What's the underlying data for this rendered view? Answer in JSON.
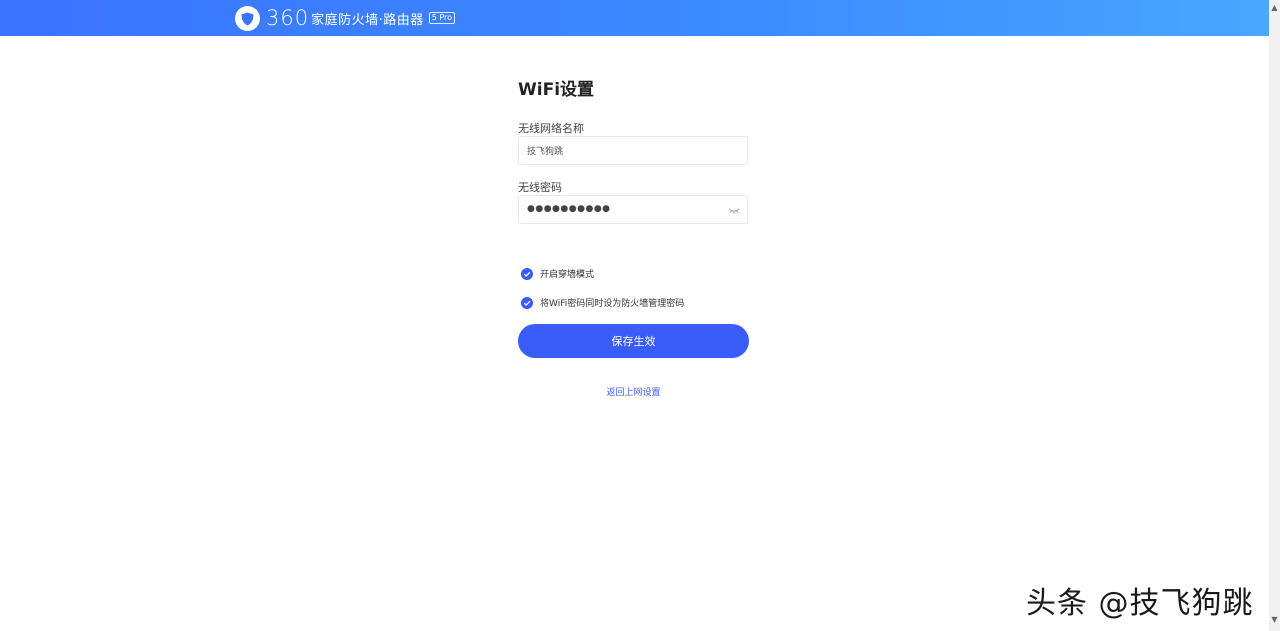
{
  "header": {
    "brand_number": "360",
    "brand_name": "家庭防火墙·路由器",
    "model_badge": "5 Pro"
  },
  "form": {
    "title": "WiFi设置",
    "ssid_label": "无线网络名称",
    "ssid_value": "技飞狗跳",
    "password_label": "无线密码",
    "password_mask": "●●●●●●●●●●",
    "options": [
      {
        "label": "开启穿墙模式",
        "checked": true
      },
      {
        "label": "将WiFi密码同时设为防火墙管理密码",
        "checked": true
      }
    ],
    "save_label": "保存生效",
    "back_link": "返回上网设置"
  },
  "watermark": "头条 @技飞狗跳",
  "colors": {
    "header_start": "#3a73ff",
    "header_end": "#4aa6ff",
    "accent": "#3a5cf8"
  },
  "icons": [
    "shield-logo-icon",
    "eye-closed-icon",
    "check-circle-icon",
    "scroll-up-icon",
    "scroll-down-icon"
  ]
}
